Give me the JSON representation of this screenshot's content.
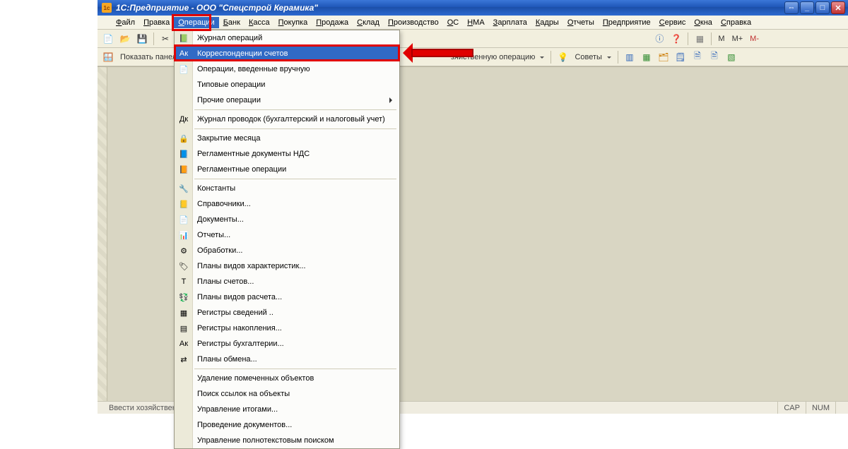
{
  "title": "1С:Предприятие - ООО \"Спецстрой Керамика\"",
  "menubar": [
    "Файл",
    "Правка",
    "Операции",
    "Банк",
    "Касса",
    "Покупка",
    "Продажа",
    "Склад",
    "Производство",
    "ОС",
    "НМА",
    "Зарплата",
    "Кадры",
    "Отчеты",
    "Предприятие",
    "Сервис",
    "Окна",
    "Справка"
  ],
  "active_menu_index": 2,
  "toolbar1_labels": {
    "m": "M",
    "mplus": "M+",
    "mminus": "M-"
  },
  "toolbar2": {
    "show_panel": "Показать панель функций",
    "op_label_tail": "зяйственную операцию",
    "tips": "Советы"
  },
  "dropdown": {
    "highlight_index": 1,
    "groups": [
      [
        {
          "icon": "📗",
          "name": "journal-ops",
          "label": "Журнал операций"
        },
        {
          "icon": "Ак",
          "name": "corr-accounts",
          "label": "Корреспонденции счетов"
        },
        {
          "icon": "📄",
          "name": "manual-ops",
          "label": "Операции, введенные вручную"
        },
        {
          "icon": "",
          "name": "typical-ops",
          "label": "Типовые операции"
        },
        {
          "icon": "",
          "name": "other-ops",
          "label": "Прочие операции",
          "submenu": true
        }
      ],
      [
        {
          "icon": "Дк",
          "name": "postings-journal",
          "label": "Журнал проводок (бухгалтерский и налоговый учет)"
        }
      ],
      [
        {
          "icon": "🔒",
          "name": "month-close",
          "label": "Закрытие месяца"
        },
        {
          "icon": "📘",
          "name": "reg-docs-vat",
          "label": "Регламентные документы НДС"
        },
        {
          "icon": "📙",
          "name": "reg-ops",
          "label": "Регламентные операции"
        }
      ],
      [
        {
          "icon": "🔧",
          "name": "constants",
          "label": "Константы"
        },
        {
          "icon": "📒",
          "name": "catalogs",
          "label": "Справочники..."
        },
        {
          "icon": "📄",
          "name": "documents",
          "label": "Документы..."
        },
        {
          "icon": "📊",
          "name": "reports",
          "label": "Отчеты..."
        },
        {
          "icon": "⚙",
          "name": "processings",
          "label": "Обработки..."
        },
        {
          "icon": "🏷",
          "name": "char-type-plans",
          "label": "Планы видов характеристик..."
        },
        {
          "icon": "Т",
          "name": "account-plans",
          "label": "Планы счетов..."
        },
        {
          "icon": "💱",
          "name": "calc-type-plans",
          "label": "Планы видов расчета..."
        },
        {
          "icon": "▦",
          "name": "info-registers",
          "label": "Регистры сведений .."
        },
        {
          "icon": "▤",
          "name": "accum-registers",
          "label": "Регистры накопления..."
        },
        {
          "icon": "Ак",
          "name": "acct-registers",
          "label": "Регистры бухгалтерии..."
        },
        {
          "icon": "⇄",
          "name": "exchange-plans",
          "label": "Планы обмена..."
        }
      ],
      [
        {
          "icon": "",
          "name": "delete-marked",
          "label": "Удаление помеченных объектов"
        },
        {
          "icon": "",
          "name": "find-refs",
          "label": "Поиск ссылок на объекты"
        },
        {
          "icon": "",
          "name": "totals-mgmt",
          "label": "Управление итогами..."
        },
        {
          "icon": "",
          "name": "post-documents",
          "label": "Проведение документов..."
        },
        {
          "icon": "",
          "name": "fulltext-mgmt",
          "label": "Управление полнотекстовым поиском"
        }
      ]
    ]
  },
  "statusbar": {
    "hint": "Ввести хозяйственную",
    "cap": "CAP",
    "num": "NUM"
  }
}
